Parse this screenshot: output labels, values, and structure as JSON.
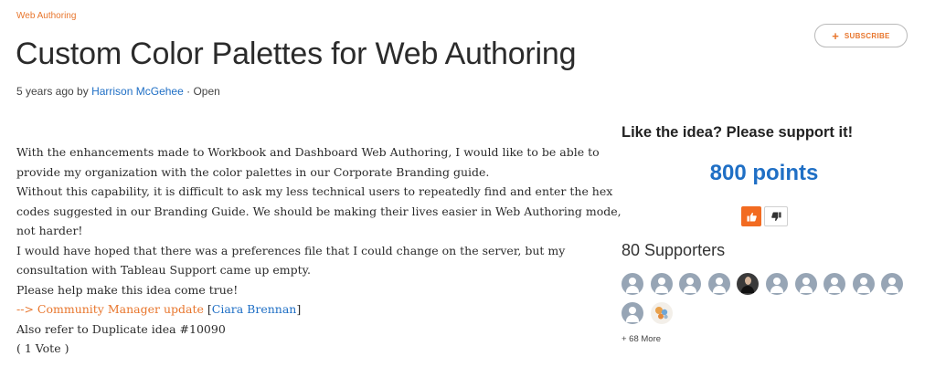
{
  "breadcrumb": "Web Authoring",
  "title": "Custom Color Palettes for Web Authoring",
  "meta": {
    "age": "5 years ago by",
    "author": "Harrison McGehee",
    "separator": "·",
    "status": "Open"
  },
  "subscribe": {
    "plus": "+",
    "label": "SUBSCRIBE"
  },
  "body": {
    "l1": "With the enhancements made to Workbook and Dashboard Web Authoring, I would like to be able to",
    "l2": "provide my organization with the color palettes in our Corporate Branding guide.",
    "l3": "Without this capability, it is difficult to ask my less technical users to repeatedly find and enter the hex",
    "l4": "codes suggested in our Branding Guide. We should be making their lives easier in Web Authoring mode,",
    "l5": "not harder!",
    "l6": "I would have hoped that there was a preferences file that I could change on the server, but my",
    "l7": "consultation with Tableau Support came up empty.",
    "l8": "Please help make this idea come true!",
    "update_link": "--> Community Manager update",
    "bracket_open": "[",
    "manager_name": "Ciara Brennan",
    "bracket_close": "]",
    "l10": "Also refer to Duplicate idea #10090",
    "l11": "( 1 Vote )"
  },
  "support": {
    "heading": "Like the idea? Please support it!",
    "points": "800 points"
  },
  "supporters": {
    "title": "80 Supporters",
    "avatars": [
      "default",
      "default",
      "default",
      "default",
      "photo",
      "default",
      "default",
      "default",
      "default",
      "default",
      "default",
      "logo"
    ],
    "more": "+ 68 More"
  },
  "colors": {
    "accent": "#e8762d",
    "link": "#1f6fc5",
    "vote": "#f26b21",
    "avatar": "#97a5b5"
  }
}
